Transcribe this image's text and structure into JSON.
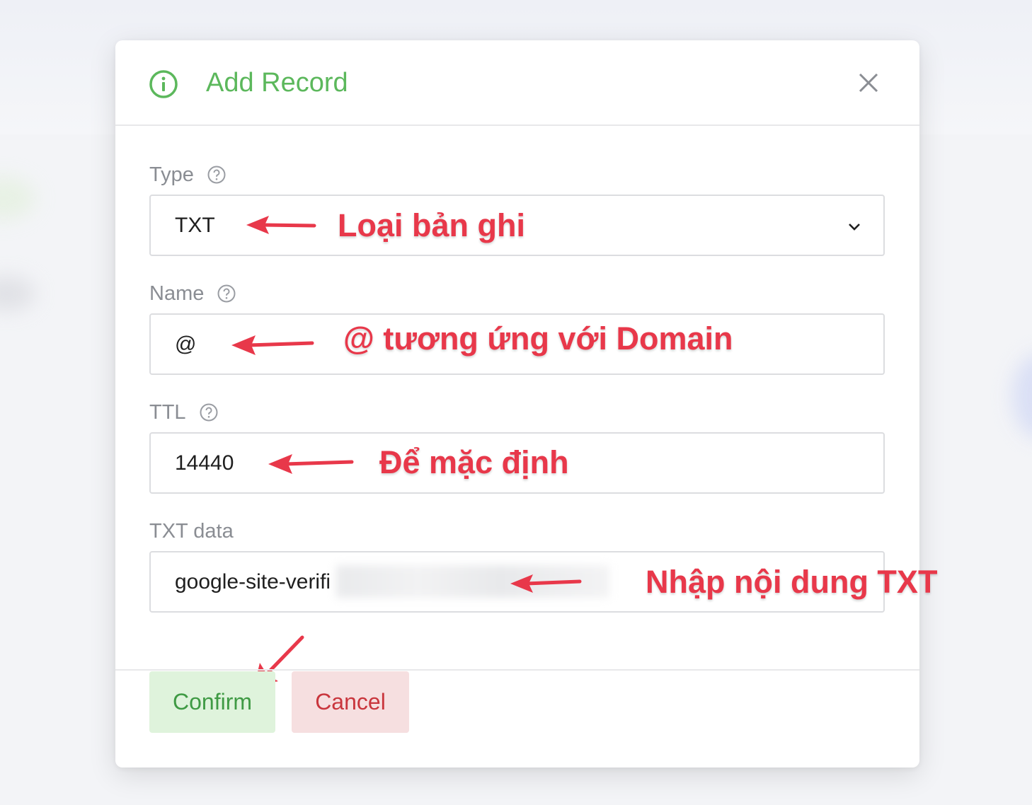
{
  "dialog": {
    "title": "Add Record",
    "icon": "info-icon",
    "close_icon": "close-icon",
    "accent_color": "#5cb85c"
  },
  "fields": {
    "type": {
      "label": "Type",
      "value": "TXT",
      "help_icon": "question-circle-icon",
      "dropdown_icon": "chevron-down-icon"
    },
    "name": {
      "label": "Name",
      "value": "@",
      "help_icon": "question-circle-icon"
    },
    "ttl": {
      "label": "TTL",
      "value": "14440",
      "help_icon": "question-circle-icon"
    },
    "txt_data": {
      "label": "TXT data",
      "value": "google-site-verifi",
      "value_partially_blurred": true
    }
  },
  "annotations": {
    "type_note": "Loại bản ghi",
    "name_note": "@ tương ứng với Domain",
    "ttl_note": "Để mặc định",
    "txt_note": "Nhập nội dung TXT",
    "color": "#e8384a"
  },
  "buttons": {
    "confirm": "Confirm",
    "cancel": "Cancel",
    "confirm_bg": "#dff3dc",
    "confirm_text_color": "#3f9a44",
    "cancel_bg": "#f6dfe0",
    "cancel_text_color": "#c9363d"
  }
}
